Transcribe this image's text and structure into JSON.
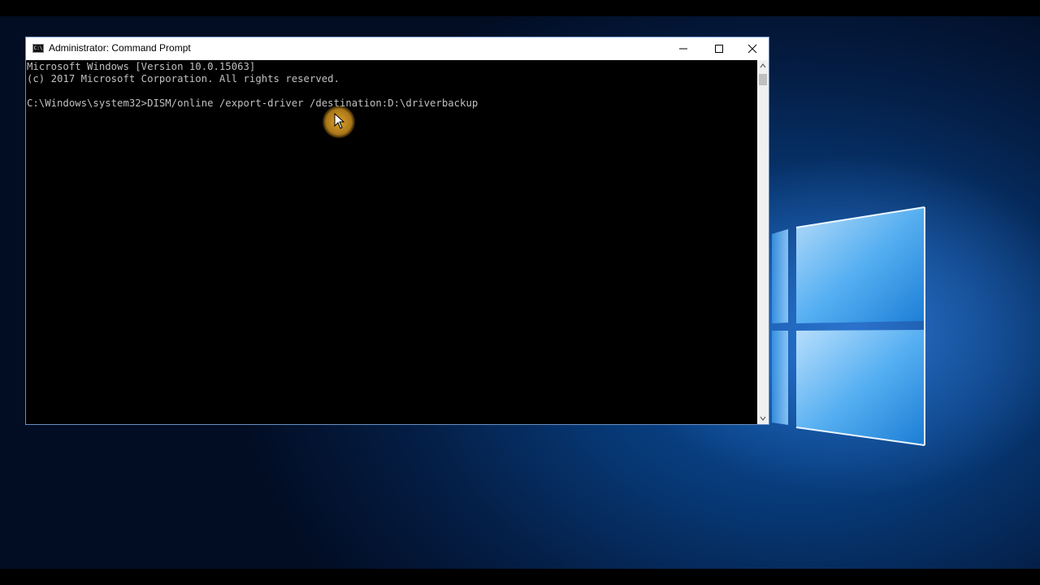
{
  "window": {
    "title": "Administrator: Command Prompt",
    "icon_text": "C:\\",
    "controls": [
      "minimize",
      "maximize",
      "close"
    ]
  },
  "console": {
    "lines": [
      "Microsoft Windows [Version 10.0.15063]",
      "(c) 2017 Microsoft Corporation. All rights reserved.",
      "",
      "C:\\Windows\\system32>DISM/online /export-driver /destination:D:\\driverbackup"
    ],
    "text_color": "#c0c0c0",
    "background": "#000000"
  },
  "desktop": {
    "wallpaper": "Windows 10 hero",
    "accent": "#0b4e9c"
  },
  "icons": {
    "minimize": "minimize-icon",
    "maximize": "maximize-icon",
    "close": "close-icon",
    "cursor": "mouse-pointer-icon"
  }
}
